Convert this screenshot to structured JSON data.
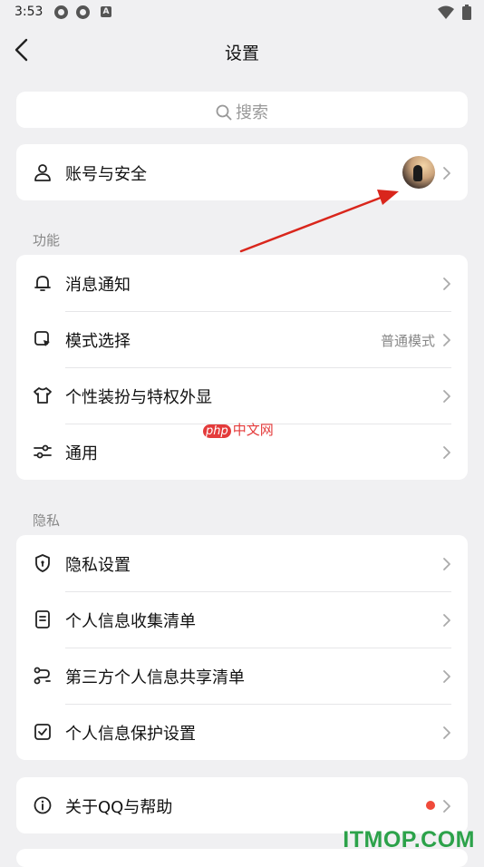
{
  "status_bar": {
    "time": "3:53",
    "app_badge": "A"
  },
  "header": {
    "title": "设置"
  },
  "search": {
    "placeholder": "搜索"
  },
  "account": {
    "label": "账号与安全"
  },
  "sections": {
    "functions": {
      "title": "功能",
      "items": [
        {
          "label": "消息通知",
          "icon": "bell-icon"
        },
        {
          "label": "模式选择",
          "value": "普通模式",
          "icon": "mode-icon"
        },
        {
          "label": "个性装扮与特权外显",
          "icon": "shirt-icon"
        },
        {
          "label": "通用",
          "icon": "sliders-icon"
        }
      ]
    },
    "privacy": {
      "title": "隐私",
      "items": [
        {
          "label": "隐私设置",
          "icon": "shield-icon"
        },
        {
          "label": "个人信息收集清单",
          "icon": "document-icon"
        },
        {
          "label": "第三方个人信息共享清单",
          "icon": "share-icon"
        },
        {
          "label": "个人信息保护设置",
          "icon": "checkbox-icon"
        }
      ]
    }
  },
  "about": {
    "label": "关于QQ与帮助",
    "badge_color": "#f04a3a"
  },
  "annotation": {
    "arrow_color": "#d9261c"
  },
  "watermarks": {
    "php_logo": "php",
    "php_text": "中文网",
    "site": "ITMOP.COM"
  }
}
